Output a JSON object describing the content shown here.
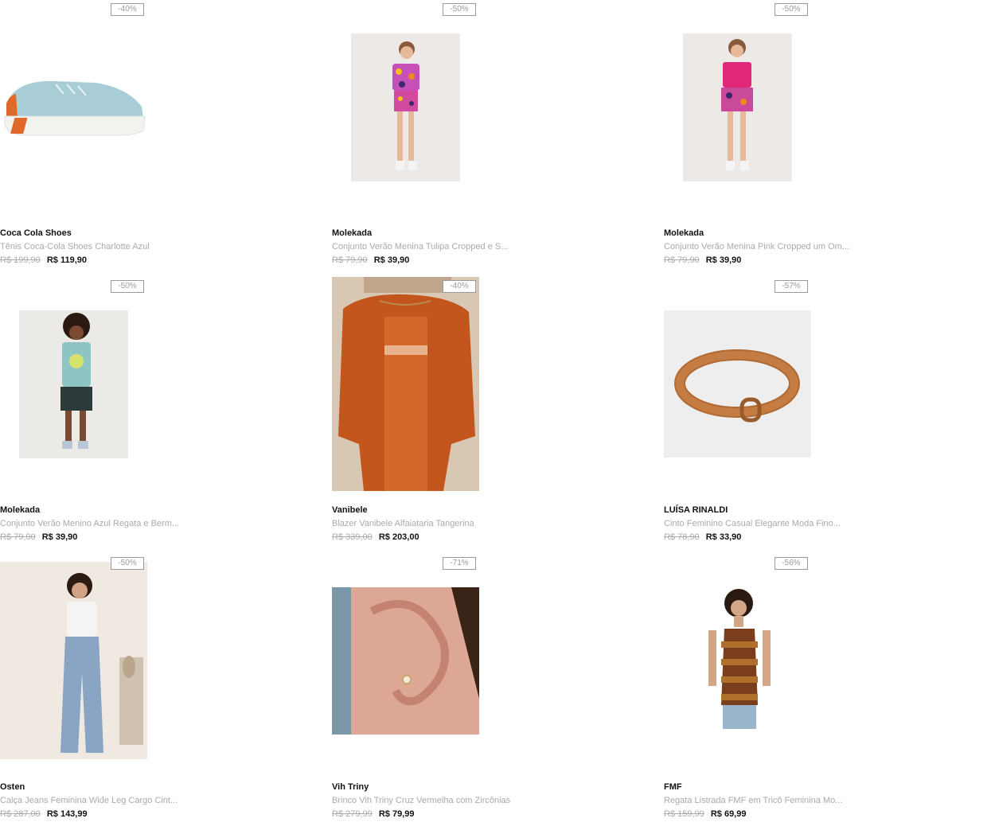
{
  "products": [
    {
      "badge": "-40%",
      "brand": "Coca Cola Shoes",
      "name": "Tênis Coca-Cola Shoes Charlotte Azul",
      "old_price": "R$ 199,90",
      "price": "R$ 119,90",
      "image_icon": "sneaker-image"
    },
    {
      "badge": "-50%",
      "brand": "Molekada",
      "name": "Conjunto Verão Menina Tulipa Cropped e S...",
      "old_price": "R$ 79,90",
      "price": "R$ 39,90",
      "image_icon": "girl-outfit-image"
    },
    {
      "badge": "-50%",
      "brand": "Molekada",
      "name": "Conjunto Verão Menina Pink Cropped um Om...",
      "old_price": "R$ 79,90",
      "price": "R$ 39,90",
      "image_icon": "girl-pink-outfit-image"
    },
    {
      "badge": "-50%",
      "brand": "Molekada",
      "name": "Conjunto Verão Menino Azul Regata e Berm...",
      "old_price": "R$ 79,90",
      "price": "R$ 39,90",
      "image_icon": "boy-outfit-image"
    },
    {
      "badge": "-40%",
      "brand": "Vanibele",
      "name": "Blazer Vanibele Alfaiataria Tangerina",
      "old_price": "R$ 339,00",
      "price": "R$ 203,00",
      "image_icon": "orange-blazer-image"
    },
    {
      "badge": "-57%",
      "brand": "LUÍSA RINALDI",
      "name": "Cinto Feminino Casual Elegante Moda Fino...",
      "old_price": "R$ 78,90",
      "price": "R$ 33,90",
      "image_icon": "belt-image"
    },
    {
      "badge": "-50%",
      "brand": "Osten",
      "name": "Calça Jeans Feminina Wide Leg Cargo Cint...",
      "old_price": "R$ 287,00",
      "price": "R$ 143,99",
      "image_icon": "jeans-image"
    },
    {
      "badge": "-71%",
      "brand": "Vih Triny",
      "name": "Brinco Vih Triny Cruz Vermelha com Zircônias",
      "old_price": "R$ 279,99",
      "price": "R$ 79,99",
      "image_icon": "earring-image"
    },
    {
      "badge": "-56%",
      "brand": "FMF",
      "name": "Regata Listrada FMF em Tricô Feminina Mo...",
      "old_price": "R$ 159,99",
      "price": "R$ 69,99",
      "image_icon": "striped-top-image"
    }
  ]
}
